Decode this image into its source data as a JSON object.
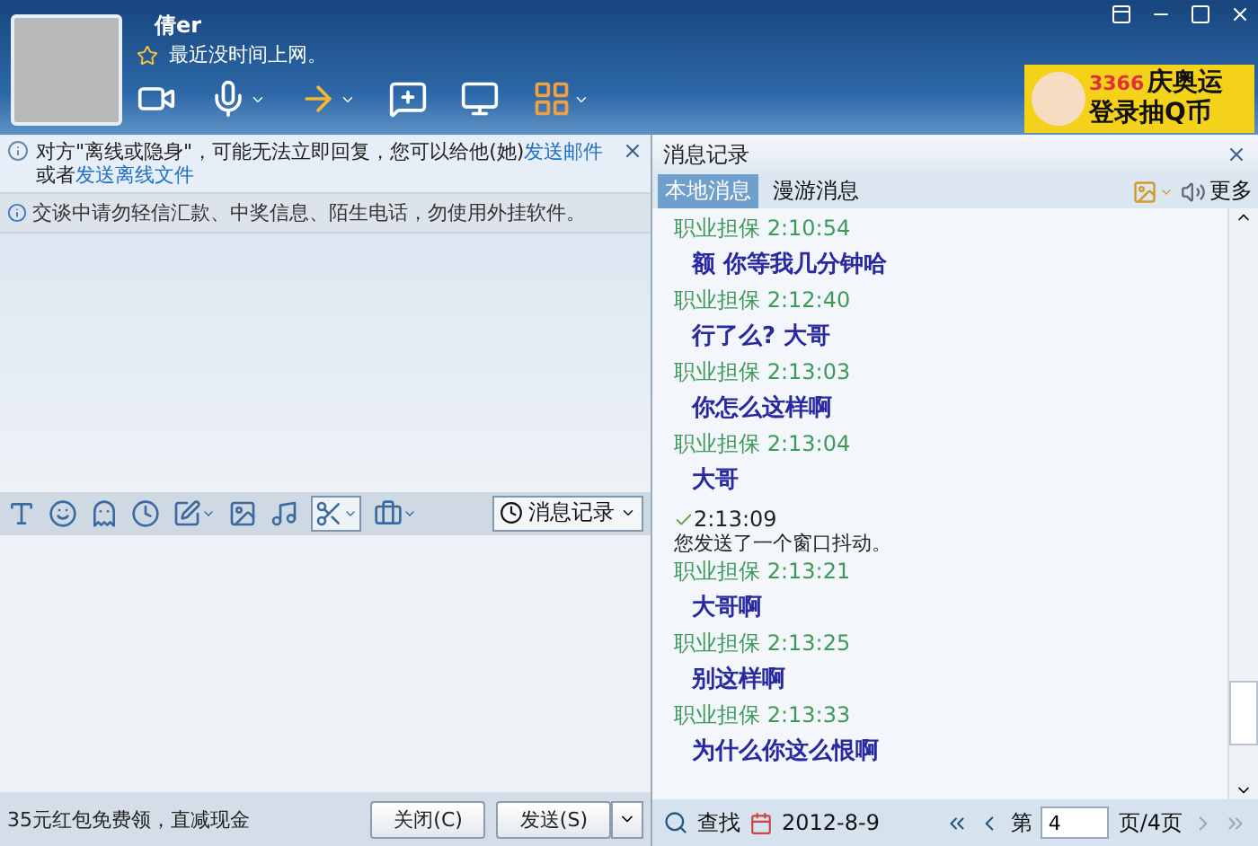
{
  "contact": {
    "name": "倩er",
    "status_message": "最近没时间上网。"
  },
  "ad_banner": {
    "brand": "3366",
    "line_1": "庆奥运",
    "line_2": "登录抽Q币"
  },
  "notice": {
    "text": "对方\"离线或隐身\"，可能无法立即回复，您可以给他(她)",
    "link_1": "发送邮件",
    "middle": "或者",
    "link_2": "发送离线文件"
  },
  "warning": "交谈中请勿轻信汇款、中奖信息、陌生电话，勿使用外挂软件。",
  "history_button": "消息记录",
  "promo": "35元红包免费领，直减现金",
  "buttons": {
    "close": "关闭(C)",
    "send": "发送(S)"
  },
  "history": {
    "title": "消息记录",
    "tabs": [
      {
        "label": "本地消息",
        "selected": true
      },
      {
        "label": "漫游消息",
        "selected": false
      }
    ],
    "more": "更多",
    "messages": [
      {
        "kind": "message",
        "sender": "职业担保",
        "time": "2:10:54",
        "text": "额 你等我几分钟哈"
      },
      {
        "kind": "message",
        "sender": "职业担保",
        "time": "2:12:40",
        "text": "行了么? 大哥"
      },
      {
        "kind": "message",
        "sender": "职业担保",
        "time": "2:13:03",
        "text": "你怎么这样啊"
      },
      {
        "kind": "message",
        "sender": "职业担保",
        "time": "2:13:04",
        "text": "大哥"
      },
      {
        "kind": "shake",
        "time": "2:13:09",
        "text": "您发送了一个窗口抖动。"
      },
      {
        "kind": "message",
        "sender": "职业担保",
        "time": "2:13:21",
        "text": "大哥啊"
      },
      {
        "kind": "message",
        "sender": "职业担保",
        "time": "2:13:25",
        "text": "别这样啊"
      },
      {
        "kind": "message",
        "sender": "职业担保",
        "time": "2:13:33",
        "text": "为什么你这么恨啊"
      }
    ],
    "search": "查找",
    "date": "2012-8-9",
    "page_prefix": "第",
    "page": "4",
    "page_suffix": "页/4页"
  }
}
